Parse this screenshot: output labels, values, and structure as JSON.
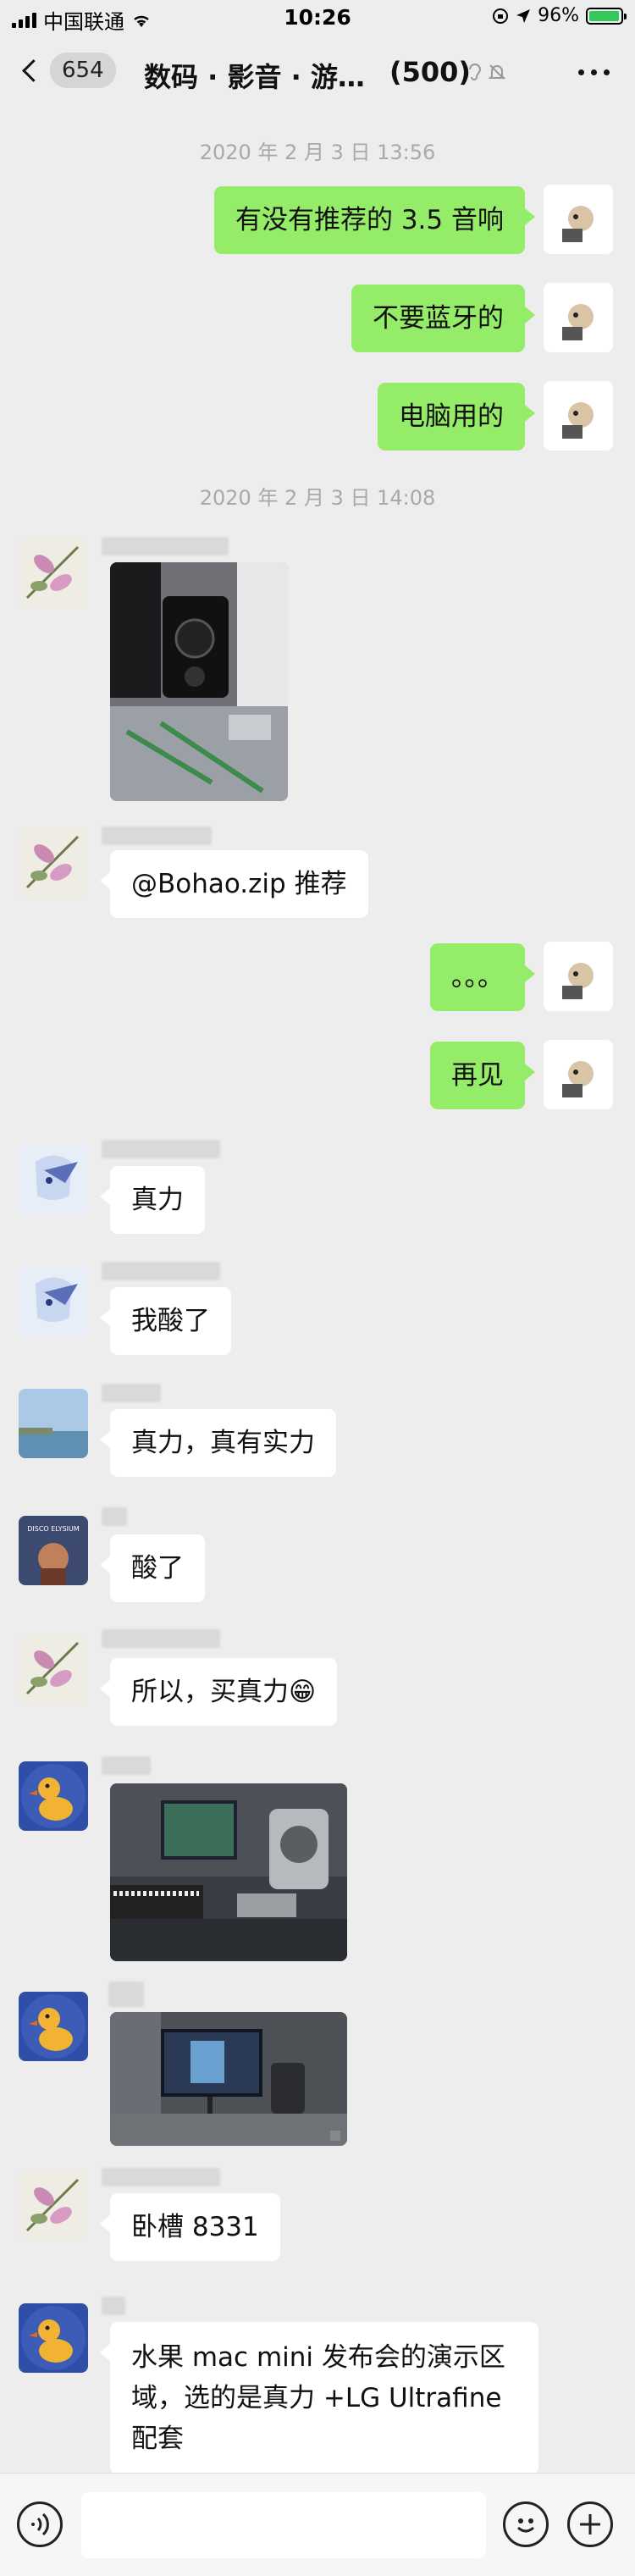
{
  "status_bar": {
    "carrier": "中国联通",
    "time": "10:26",
    "battery": "96%",
    "battery_level": 0.96
  },
  "nav": {
    "back_count": "654",
    "title": "数码 · 影音 · 游…",
    "member_count": "(500)"
  },
  "timestamps": [
    "2020 年 2 月 3 日 13:56",
    "2020 年 2 月 3 日 14:08"
  ],
  "messages": {
    "m1": "有没有推荐的 3.5 音响",
    "m2": "不要蓝牙的",
    "m3": "电脑用的",
    "m4": "@Bohao.zip 推荐",
    "m5": "。。。",
    "m6": "再见",
    "m7": "真力",
    "m8": "我酸了",
    "m9": "真力，真有实力",
    "m10": "酸了",
    "m11": "所以，买真力",
    "m11_emoji": "😁",
    "m12": "卧槽 8331",
    "m13": "水果 mac mini 发布会的演示区域，选的是真力 +LG Ultrafine 配套"
  },
  "avatars": {
    "disco_text": "DISCO ELYSIUM"
  },
  "colors": {
    "outgoing_bubble": "#95ec69",
    "incoming_bubble": "#ffffff",
    "background": "#ededed"
  },
  "icons": {
    "voice": "voice-icon",
    "emoji": "emoji-icon",
    "plus": "plus-icon"
  }
}
